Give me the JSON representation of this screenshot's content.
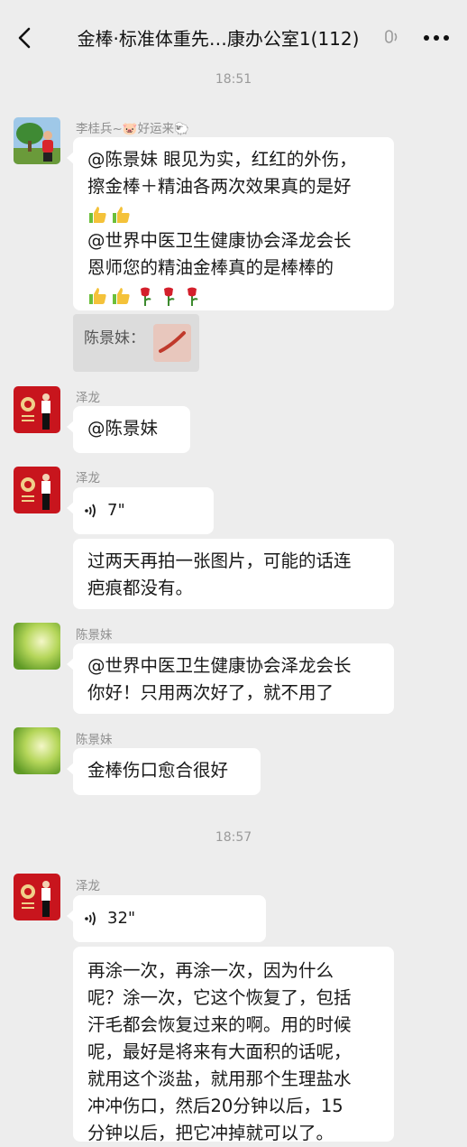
{
  "header": {
    "title": "金棒·标准体重先…康办公室1(112)",
    "back_icon": "chevron-left-icon",
    "voice_icon": "voice-mode-icon",
    "more_icon": "more-dots-icon"
  },
  "timestamps": [
    "18:51",
    "18:57"
  ],
  "messages": [
    {
      "sender": "李桂兵~🐷好运来🐑",
      "lines": [
        "@陈景妹  眼见为实，红红的外伤，",
        "擦金棒＋精油各两次效果真的是好",
        "@世界中医卫生健康协会泽龙会长",
        " 恩师您的精油金棒真的是棒棒的"
      ],
      "emojis_1": [
        "thumbs-up",
        "thumbs-up"
      ],
      "emojis_2": [
        "thumbs-up",
        "thumbs-up",
        "rose",
        "rose",
        "rose"
      ],
      "quote": {
        "text": "陈景妹：",
        "thumb_icon": "wound-photo"
      }
    },
    {
      "sender": "泽龙",
      "text": "@陈景妹"
    },
    {
      "sender": "泽龙",
      "voice_duration": "7\"",
      "text_lines": [
        "过两天再拍一张图片，可能的话连",
        "疤痕都没有。"
      ]
    },
    {
      "sender": "陈景妹",
      "lines": [
        "@世界中医卫生健康协会泽龙会长",
        " 你好！只用两次好了，就不用了"
      ]
    },
    {
      "sender": "陈景妹",
      "text": "金棒伤口愈合很好"
    },
    {
      "sender": "泽龙",
      "voice_duration": "32\"",
      "text_lines": [
        "再涂一次，再涂一次，因为什么",
        "呢？涂一次，它这个恢复了，包括",
        "汗毛都会恢复过来的啊。用的时候",
        "呢，最好是将来有大面积的话呢，",
        "就用这个淡盐，就用那个生理盐水",
        "冲冲伤口，然后20分钟以后，15",
        "分钟以后，把它冲掉就可以了。"
      ]
    }
  ],
  "colors": {
    "background": "#ededed",
    "bubble": "#ffffff",
    "accent_red": "#c8151d"
  }
}
